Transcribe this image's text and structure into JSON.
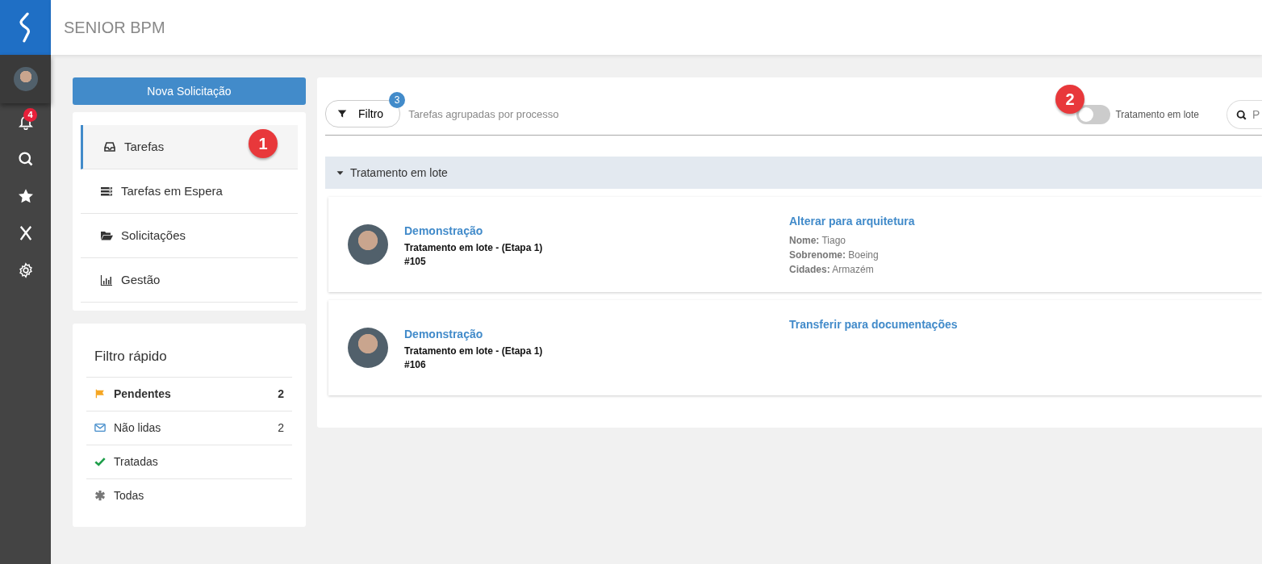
{
  "app": {
    "title": "SENIOR BPM"
  },
  "rail": {
    "notifications_badge": "4",
    "items": [
      {
        "kind": "bell"
      },
      {
        "kind": "search"
      },
      {
        "kind": "star"
      },
      {
        "kind": "x"
      },
      {
        "kind": "gear"
      }
    ]
  },
  "new_request_button": "Nova Solicitação",
  "nav": [
    {
      "label": "Tarefas",
      "kind": "inbox",
      "selected": true
    },
    {
      "label": "Tarefas em Espera",
      "kind": "stack",
      "selected": false
    },
    {
      "label": "Solicitações",
      "kind": "folder",
      "selected": false
    },
    {
      "label": "Gestão",
      "kind": "chart",
      "selected": false
    }
  ],
  "quick_filter": {
    "title": "Filtro rápido",
    "items": [
      {
        "label": "Pendentes",
        "kind": "flag",
        "count": "2",
        "selected": true
      },
      {
        "label": "Não lidas",
        "kind": "mail",
        "count": "2",
        "selected": false
      },
      {
        "label": "Tratadas",
        "kind": "check",
        "selected": false
      },
      {
        "label": "Todas",
        "kind": "asterisk",
        "selected": false
      }
    ]
  },
  "toolbar": {
    "filter_button": "Filtro",
    "filter_badge": "3",
    "hint": "Tarefas agrupadas por processo",
    "batch_toggle": {
      "label": "Tratamento em lote",
      "on": false
    },
    "search": {
      "placeholder": "P"
    }
  },
  "group": {
    "title": "Tratamento em lote",
    "expanded": true
  },
  "tasks": [
    {
      "process": "Demonstração",
      "subtitle": "Tratamento em lote - (Etapa 1)",
      "number": "#105",
      "action": "Alterar para arquitetura",
      "fields": [
        {
          "label": "Nome:",
          "value": "Tiago"
        },
        {
          "label": "Sobrenome:",
          "value": "Boeing"
        },
        {
          "label": "Cidades:",
          "value": "Armazém"
        }
      ]
    },
    {
      "process": "Demonstração",
      "subtitle": "Tratamento em lote - (Etapa 1)",
      "number": "#106",
      "action": "Transferir para documentações"
    }
  ],
  "callouts": [
    "1",
    "2"
  ]
}
